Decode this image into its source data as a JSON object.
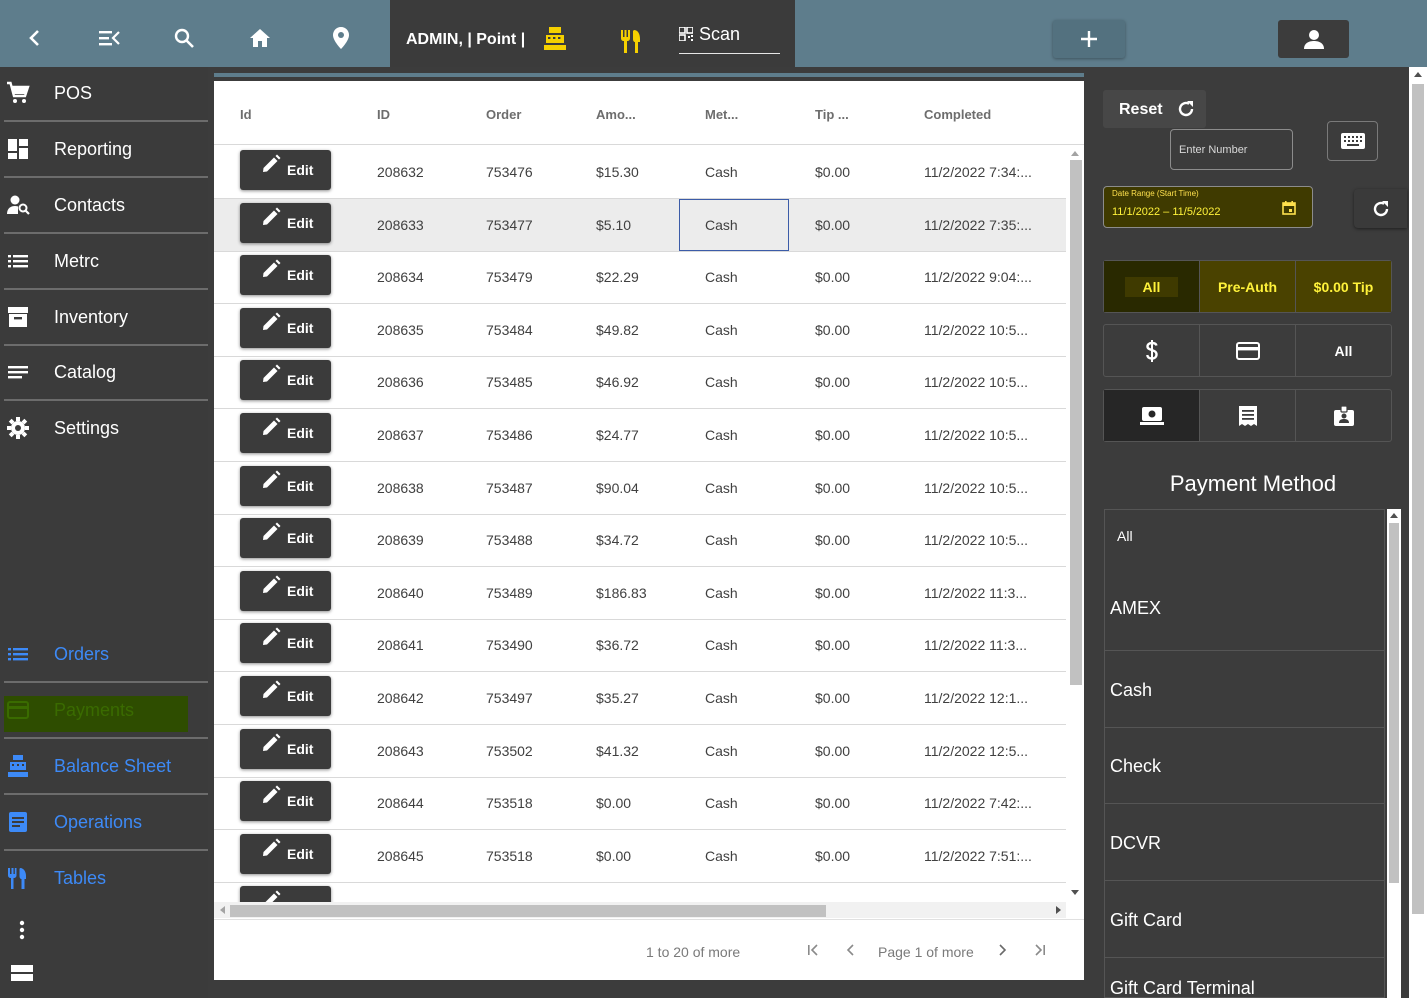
{
  "topbar": {
    "admin_text": "ADMIN, | Point |",
    "scan_label": "Scan"
  },
  "sidebar": {
    "items": [
      {
        "label": "POS",
        "icon": "cart-icon"
      },
      {
        "label": "Reporting",
        "icon": "dashboard-icon"
      },
      {
        "label": "Contacts",
        "icon": "person-search-icon"
      },
      {
        "label": "Metrc",
        "icon": "list-icon"
      },
      {
        "label": "Inventory",
        "icon": "archive-icon"
      },
      {
        "label": "Catalog",
        "icon": "lines-icon"
      },
      {
        "label": "Settings",
        "icon": "gear-icon"
      }
    ],
    "sub_items": [
      {
        "label": "Orders",
        "icon": "list-icon"
      },
      {
        "label": "Payments",
        "icon": "credit-card-icon"
      },
      {
        "label": "Balance Sheet",
        "icon": "register-icon"
      },
      {
        "label": "Operations",
        "icon": "document-icon"
      },
      {
        "label": "Tables",
        "icon": "utensils-icon"
      }
    ]
  },
  "table": {
    "columns": [
      "Id",
      "ID",
      "Order",
      "Amo...",
      "Met...",
      "Tip ...",
      "Completed"
    ],
    "edit_label": "Edit",
    "rows": [
      {
        "id": "208632",
        "order": "753476",
        "amount": "$15.30",
        "method": "Cash",
        "tip": "$0.00",
        "completed": "11/2/2022 7:34:..."
      },
      {
        "id": "208633",
        "order": "753477",
        "amount": "$5.10",
        "method": "Cash",
        "tip": "$0.00",
        "completed": "11/2/2022 7:35:..."
      },
      {
        "id": "208634",
        "order": "753479",
        "amount": "$22.29",
        "method": "Cash",
        "tip": "$0.00",
        "completed": "11/2/2022 9:04:..."
      },
      {
        "id": "208635",
        "order": "753484",
        "amount": "$49.82",
        "method": "Cash",
        "tip": "$0.00",
        "completed": "11/2/2022 10:5..."
      },
      {
        "id": "208636",
        "order": "753485",
        "amount": "$46.92",
        "method": "Cash",
        "tip": "$0.00",
        "completed": "11/2/2022 10:5..."
      },
      {
        "id": "208637",
        "order": "753486",
        "amount": "$24.77",
        "method": "Cash",
        "tip": "$0.00",
        "completed": "11/2/2022 10:5..."
      },
      {
        "id": "208638",
        "order": "753487",
        "amount": "$90.04",
        "method": "Cash",
        "tip": "$0.00",
        "completed": "11/2/2022 10:5..."
      },
      {
        "id": "208639",
        "order": "753488",
        "amount": "$34.72",
        "method": "Cash",
        "tip": "$0.00",
        "completed": "11/2/2022 10:5..."
      },
      {
        "id": "208640",
        "order": "753489",
        "amount": "$186.83",
        "method": "Cash",
        "tip": "$0.00",
        "completed": "11/2/2022 11:3..."
      },
      {
        "id": "208641",
        "order": "753490",
        "amount": "$36.72",
        "method": "Cash",
        "tip": "$0.00",
        "completed": "11/2/2022 11:3..."
      },
      {
        "id": "208642",
        "order": "753497",
        "amount": "$35.27",
        "method": "Cash",
        "tip": "$0.00",
        "completed": "11/2/2022 12:1..."
      },
      {
        "id": "208643",
        "order": "753502",
        "amount": "$41.32",
        "method": "Cash",
        "tip": "$0.00",
        "completed": "11/2/2022 12:5..."
      },
      {
        "id": "208644",
        "order": "753518",
        "amount": "$0.00",
        "method": "Cash",
        "tip": "$0.00",
        "completed": "11/2/2022 7:42:..."
      },
      {
        "id": "208645",
        "order": "753518",
        "amount": "$0.00",
        "method": "Cash",
        "tip": "$0.00",
        "completed": "11/2/2022 7:51:..."
      }
    ],
    "selected_row_index": 1,
    "footer": {
      "range": "1 to 20 of more",
      "page": "Page 1 of more"
    }
  },
  "filters": {
    "reset_label": "Reset",
    "number_placeholder": "Enter Number",
    "date_label": "Date Range (Start Time)",
    "date_value": "11/1/2022 – 11/5/2022",
    "status_buttons": [
      "All",
      "Pre-Auth",
      "$0.00 Tip"
    ],
    "type_buttons": [
      {
        "icon": "dollar-icon",
        "label": ""
      },
      {
        "icon": "credit-card-icon",
        "label": ""
      },
      {
        "icon": "",
        "label": "All"
      }
    ],
    "channel_buttons": [
      "cash-register-icon",
      "receipt-icon",
      "id-badge-icon"
    ],
    "payment_method_title": "Payment Method",
    "payment_methods": [
      "All",
      "AMEX",
      "Cash",
      "Check",
      "DCVR",
      "Gift Card",
      "Gift Card Terminal"
    ]
  },
  "colors": {
    "topbar": "#5e7d8c",
    "accent_yellow": "#f5d000",
    "nav_blue": "#3d8af7"
  }
}
